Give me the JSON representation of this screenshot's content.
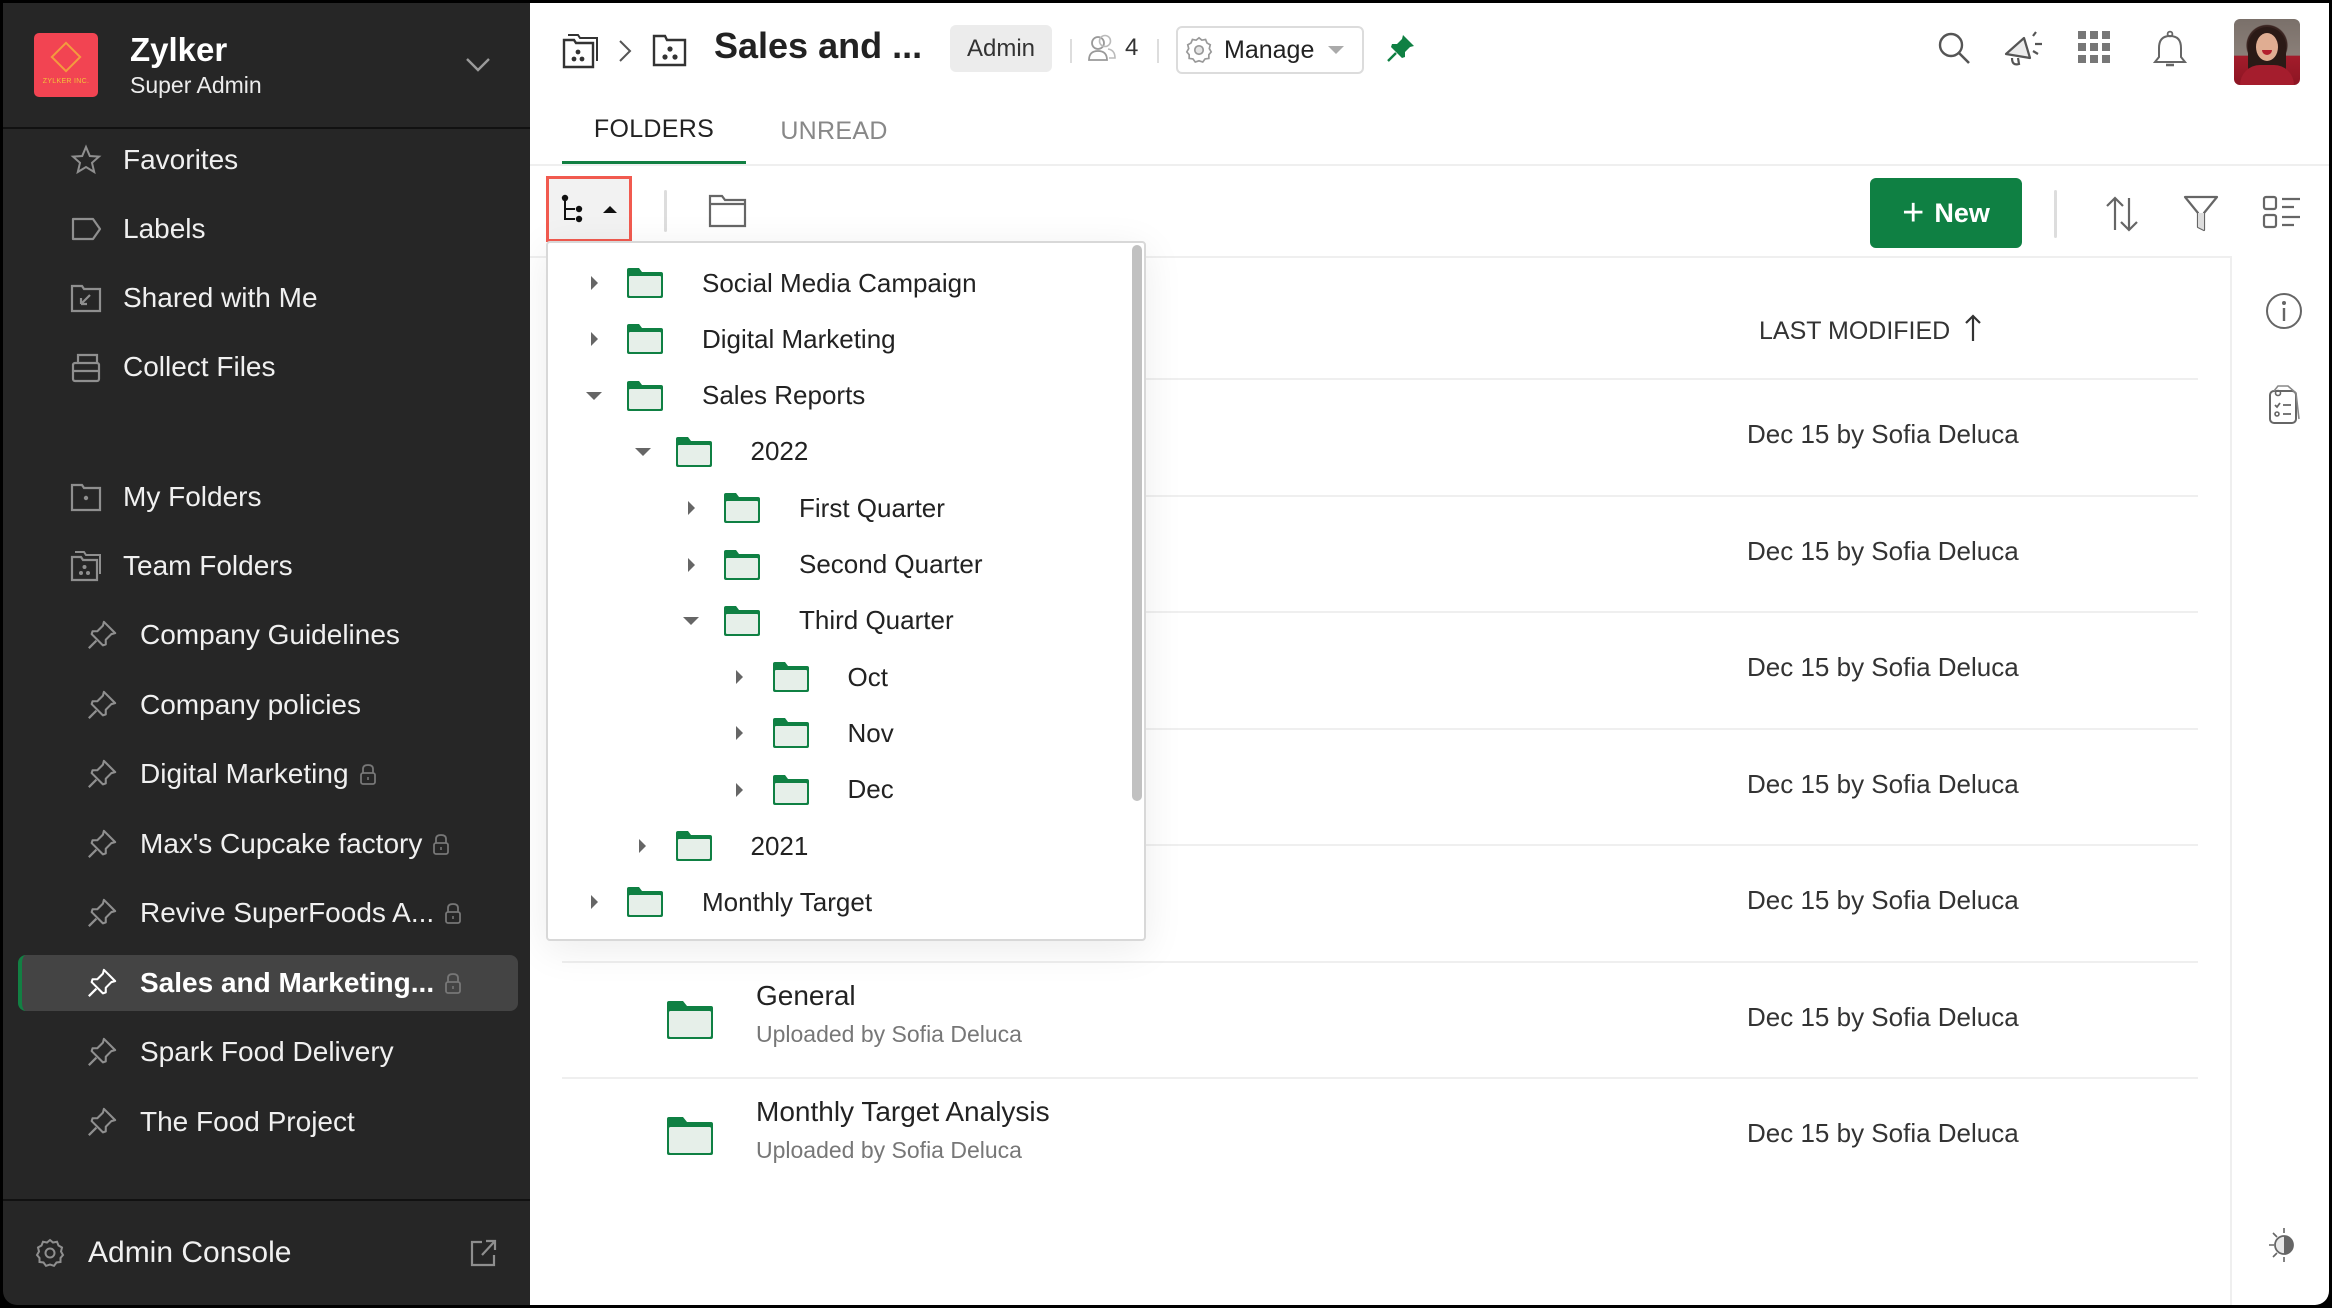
{
  "org": {
    "name": "Zylker",
    "role": "Super Admin",
    "logo_text": "ZYLKER INC.",
    "logo_color": "#f24452"
  },
  "sidebar": {
    "primary": [
      {
        "label": "Favorites",
        "icon": "star-icon"
      },
      {
        "label": "Labels",
        "icon": "label-icon"
      },
      {
        "label": "Shared with Me",
        "icon": "shared-folder-icon"
      },
      {
        "label": "Collect Files",
        "icon": "collect-files-icon"
      }
    ],
    "sections": [
      {
        "label": "My Folders",
        "icon": "my-folders-icon"
      },
      {
        "label": "Team Folders",
        "icon": "team-folders-icon"
      }
    ],
    "team_folders": [
      {
        "label": "Company Guidelines",
        "locked": false,
        "active": false
      },
      {
        "label": "Company policies",
        "locked": false,
        "active": false
      },
      {
        "label": "Digital Marketing",
        "locked": true,
        "active": false
      },
      {
        "label": "Max's Cupcake factory",
        "locked": true,
        "active": false
      },
      {
        "label": "Revive SuperFoods A...",
        "locked": true,
        "active": false
      },
      {
        "label": "Sales and Marketing...",
        "locked": true,
        "active": true
      },
      {
        "label": "Spark Food Delivery",
        "locked": false,
        "active": false
      },
      {
        "label": "The Food Project",
        "locked": false,
        "active": false
      }
    ],
    "footer": {
      "label": "Admin Console"
    }
  },
  "header": {
    "title": "Sales and ...",
    "role_badge": "Admin",
    "member_count": "4",
    "manage_label": "Manage",
    "accent": "#0f8043"
  },
  "tabs": [
    {
      "label": "FOLDERS",
      "active": true
    },
    {
      "label": "UNREAD",
      "active": false
    }
  ],
  "toolbar": {
    "new_label": "New"
  },
  "list": {
    "sort_column": "LAST MODIFIED",
    "sort_direction": "ascending",
    "rows": [
      {
        "name": "",
        "sub": "",
        "modified": "Dec 15 by Sofia Deluca"
      },
      {
        "name": "",
        "sub": "",
        "modified": "Dec 15 by Sofia Deluca"
      },
      {
        "name": "",
        "sub": "",
        "modified": "Dec 15 by Sofia Deluca"
      },
      {
        "name": "",
        "sub": "",
        "modified": "Dec 15 by Sofia Deluca"
      },
      {
        "name": "",
        "sub": "",
        "modified": "Dec 15 by Sofia Deluca"
      },
      {
        "name": "General",
        "sub": "Uploaded by Sofia Deluca",
        "modified": "Dec 15 by Sofia Deluca"
      },
      {
        "name": "Monthly Target Analysis",
        "sub": "Uploaded by Sofia Deluca",
        "modified": "Dec 15 by Sofia Deluca"
      }
    ]
  },
  "tree": [
    {
      "label": "Social Media Campaign",
      "depth": 0,
      "expanded": false
    },
    {
      "label": "Digital Marketing",
      "depth": 0,
      "expanded": false
    },
    {
      "label": "Sales Reports",
      "depth": 0,
      "expanded": true
    },
    {
      "label": "2022",
      "depth": 1,
      "expanded": true
    },
    {
      "label": "First Quarter",
      "depth": 2,
      "expanded": false
    },
    {
      "label": "Second Quarter",
      "depth": 2,
      "expanded": false
    },
    {
      "label": "Third Quarter",
      "depth": 2,
      "expanded": true
    },
    {
      "label": "Oct",
      "depth": 3,
      "expanded": false
    },
    {
      "label": "Nov",
      "depth": 3,
      "expanded": false
    },
    {
      "label": "Dec",
      "depth": 3,
      "expanded": false
    },
    {
      "label": "2021",
      "depth": 1,
      "expanded": false
    },
    {
      "label": "Monthly Target",
      "depth": 0,
      "expanded": false
    }
  ]
}
